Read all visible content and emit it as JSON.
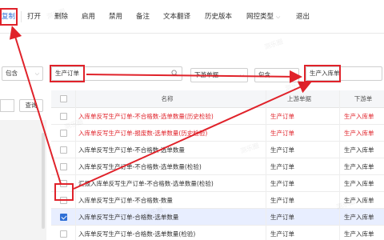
{
  "toolbar": {
    "copy": "复制",
    "open": "打开",
    "delete": "删除",
    "enable": "启用",
    "disable": "禁用",
    "remark": "备注",
    "translate": "文本翻译",
    "history": "历史版本",
    "net_type": "网控类型",
    "exit": "退出"
  },
  "filters": {
    "left_op": "包含",
    "left_value": "生产订单",
    "mid_field": "下游单据",
    "mid_op": "包含",
    "right_value": "生产入库单"
  },
  "left_panel": {
    "query_label": "查询"
  },
  "grid": {
    "headers": {
      "name": "名称",
      "upstream": "上游单据",
      "downstream": "下游单"
    },
    "rows": [
      {
        "name": "入库单反写生产订单-不合格数-选单数量(历史检验)",
        "up": "生产订单",
        "down": "生产入库单",
        "red": true,
        "checked": false
      },
      {
        "name": "入库单反写生产订单-报废数-选单数量(历史检验)",
        "up": "生产订单",
        "down": "生产入库单",
        "red": true,
        "checked": false
      },
      {
        "name": "入库单反写生产订单-不合格数-选单数量",
        "up": "生产订单",
        "down": "生产入库单",
        "red": false,
        "checked": false
      },
      {
        "name": "入库单反写生产订单-不合格数-选单数量(检验)",
        "up": "生产订单",
        "down": "生产入库单",
        "red": false,
        "checked": false
      },
      {
        "name": "汇报入库单反写生产订单-不合格数-选单数量(检验)",
        "up": "生产订单",
        "down": "生产入库单",
        "red": false,
        "checked": false
      },
      {
        "name": "入库单反写生产订单-不合格数-数量",
        "up": "生产订单",
        "down": "生产入库单",
        "red": false,
        "checked": false
      },
      {
        "name": "入库单反写生产订单-合格数-选单数量",
        "up": "生产订单",
        "down": "生产入库单",
        "red": false,
        "checked": true
      },
      {
        "name": "入库单反写生产订单-合格数-选单数量(检验)",
        "up": "生产订单",
        "down": "生产入库单",
        "red": false,
        "checked": false
      }
    ]
  },
  "watermark": "测乐圈",
  "colors": {
    "accent": "#2f6fd6",
    "annotation": "#e0222a",
    "selected_row": "#e8eeff"
  }
}
